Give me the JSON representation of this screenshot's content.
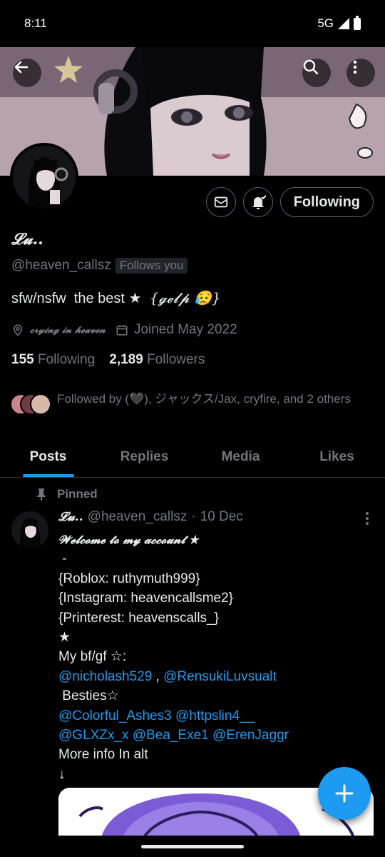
{
  "status_bar": {
    "time": "8:11",
    "network": "5G"
  },
  "profile": {
    "name": "𝓛𝓾..",
    "handle": "@heaven_callsz",
    "follows_you": "Follows you",
    "bio_main": "sfw/nsfw  the best ★  ",
    "bio_fancy": "{𝓰𝓮𝓵𝓹 😥}",
    "location": "𝓬𝓻𝔂𝓲𝓷𝓰 𝓲𝓷 𝓱𝓮𝓪𝓿𝓮𝓷",
    "joined": "Joined May 2022",
    "following_count": "155",
    "following_label": "Following",
    "followers_count": "2,189",
    "followers_label": "Followers",
    "followed_by": "Followed by (🖤), ジャックス/Jax, cryfire, and 2 others"
  },
  "actions": {
    "following_button": "Following"
  },
  "tabs": [
    {
      "label": "Posts"
    },
    {
      "label": "Replies"
    },
    {
      "label": "Media"
    },
    {
      "label": "Likes"
    }
  ],
  "post": {
    "pinned_label": "Pinned",
    "author_name": "𝓛𝓾..",
    "author_handle": "@heaven_callsz",
    "dot": "·",
    "date": "10 Dec",
    "title": "𝓦𝓮𝓵𝓬𝓸𝓶𝓮 𝓽𝓸 𝓶𝔂 𝓪𝓬𝓬𝓸𝓾𝓷𝓽 ★",
    "lines": [
      " -",
      "{Roblox: ruthymuth999}",
      "{Instagram: heavencallsme2}",
      "{Printerest: heavenscalls_}",
      "★",
      "My bf/gf ☆:"
    ],
    "mention_1": "@nicholash529",
    "mention_sep": " , ",
    "mention_2": "@RensukiLuvsualt",
    "besties": " Besties☆",
    "mention_3": "@Colorful_Ashes3",
    "mention_4": "@httpslin4__",
    "mention_5": "@GLXZx_x",
    "mention_6": "@Bea_Exe1",
    "mention_7": "@ErenJaggr",
    "more_info": "More info In alt",
    "arrow": "↓"
  },
  "colors": {
    "accent": "#1d9bf0",
    "muted": "#71767b",
    "text": "#e7e9ea"
  }
}
